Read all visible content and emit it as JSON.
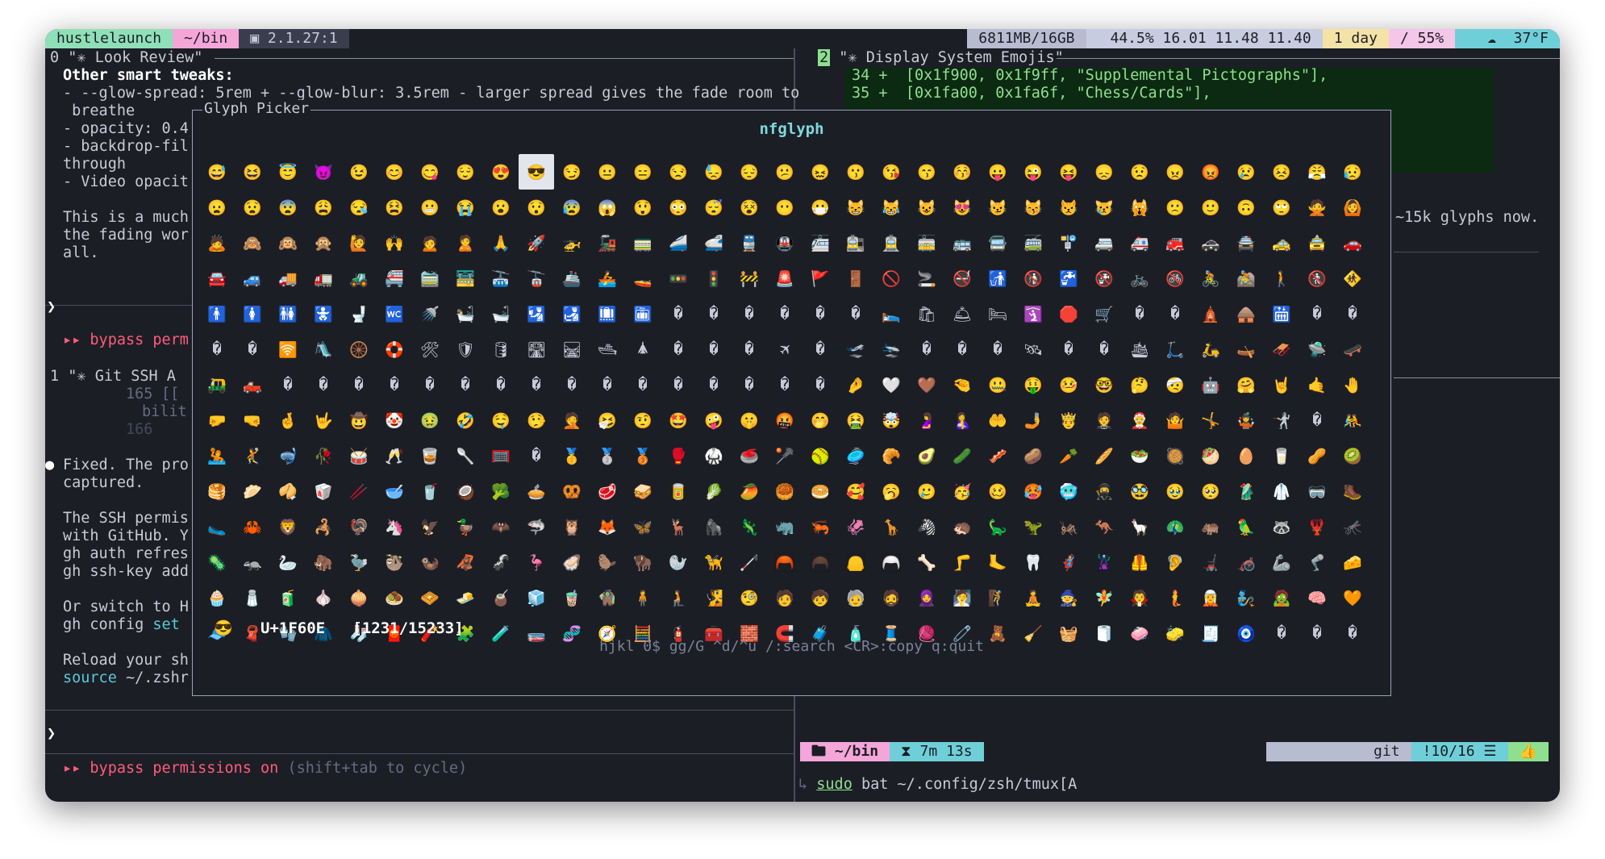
{
  "statusbar": {
    "session": "hustlelaunch",
    "dir": "~/bin",
    "pane_index": "2.1.27:1",
    "memory": "6811MB/16GB",
    "cpu": "44.5% 16.01 11.48 11.40",
    "uptime": "1 day",
    "disk": "/ 55%",
    "weather": "37°F"
  },
  "left_pane": {
    "window0_title": "0 \"✳ Look Review\"",
    "heading": "Other smart tweaks:",
    "line1": "- --glow-spread: 5rem + --glow-blur: 3.5rem - larger spread gives the fade room to",
    "line2": " breathe",
    "line3": "- opacity: 0.4",
    "line4": "- backdrop-fil",
    "line5": "through",
    "line6": "- Video opacit",
    "line7": "This is a much",
    "line8": "the fading wor",
    "line9": "all.",
    "prompt1": "❯",
    "bypass1": "▸▸ bypass perm",
    "window1_title": "1 \"✳ Git SSH A",
    "ln165": "165",
    "ln166": "166",
    "code165": "[[",
    "code_bilit": "bilit",
    "fixed1": "Fixed. The pro",
    "fixed2": "captured.",
    "ssh1": "The SSH permis",
    "ssh2": "with GitHub. Y",
    "ssh3": "gh auth refres",
    "ssh4": "gh ssh-key add",
    "or1": "Or switch to H",
    "or2": "gh config",
    "or2b": "set",
    "reload1": "Reload your sh",
    "reload2": "source",
    "reload2b": "~/.zshr",
    "prompt2": "❯",
    "bypass2a": "▸▸ bypass permissions on",
    "bypass2b": "(shift+tab to cycle)"
  },
  "right_pane": {
    "window_num": "2",
    "title": "\"✳ Display System Emojis\"",
    "line34": "34 +  [0x1f900, 0x1f9ff, \"Supplemental Pictographs\"],",
    "line35": "35 +  [0x1fa00, 0x1fa6f, \"Chess/Cards\"],",
    "glyphs_note": "~15k glyphs now.",
    "prompt_dir": "~/bin",
    "prompt_time": "7m 13s",
    "git_status": "!10/16",
    "command_sudo": "sudo",
    "command_rest": "bat ~/.config/zsh/tmux[A"
  },
  "picker": {
    "title": "Glyph Picker",
    "name": "nfglyph",
    "selected_glyph": "😎",
    "codepoint": "U+1F60E",
    "position": "[1231/15233]",
    "hints": "hjkl 0$ gg/G ^d/^u /:search <CR>:copy q:quit",
    "selected_index": 9,
    "glyphs": [
      "😅",
      "😆",
      "😇",
      "😈",
      "😉",
      "😊",
      "😋",
      "😌",
      "😍",
      "😎",
      "😏",
      "😐",
      "😑",
      "😒",
      "😓",
      "😔",
      "😕",
      "😖",
      "😗",
      "😘",
      "😙",
      "😚",
      "😛",
      "😜",
      "😝",
      "😞",
      "😟",
      "😠",
      "😡",
      "😢",
      "😣",
      "😤",
      "😥",
      "😦",
      "😧",
      "😨",
      "😩",
      "😪",
      "😫",
      "😬",
      "😭",
      "😮",
      "😯",
      "😰",
      "😱",
      "😲",
      "😳",
      "😴",
      "😵",
      "😶",
      "😷",
      "😸",
      "😹",
      "😺",
      "😻",
      "😼",
      "😽",
      "😾",
      "😿",
      "🙀",
      "🙁",
      "🙂",
      "🙃",
      "🙄",
      "🙅",
      "🙆",
      "🙇",
      "🙈",
      "🙉",
      "🙊",
      "🙋",
      "🙌",
      "🙍",
      "🙎",
      "🙏",
      "🚀",
      "🚁",
      "🚂",
      "🚃",
      "🚄",
      "🚅",
      "🚆",
      "🚇",
      "🚈",
      "🚉",
      "🚊",
      "🚋",
      "🚌",
      "🚍",
      "🚎",
      "🚏",
      "🚐",
      "🚑",
      "🚒",
      "🚓",
      "🚔",
      "🚕",
      "🚖",
      "🚗",
      "🚘",
      "🚙",
      "🚚",
      "🚛",
      "🚜",
      "🚝",
      "🚞",
      "🚟",
      "🚠",
      "🚡",
      "🚢",
      "🚣",
      "🚤",
      "🚥",
      "🚦",
      "🚧",
      "🚨",
      "🚩",
      "🚪",
      "🚫",
      "🚬",
      "🚭",
      "🚮",
      "🚯",
      "🚰",
      "🚱",
      "🚲",
      "🚳",
      "🚴",
      "🚵",
      "🚶",
      "🚷",
      "🚸",
      "🚹",
      "🚺",
      "🚻",
      "🚼",
      "🚽",
      "🚾",
      "🚿",
      "🛀",
      "🛁",
      "🛂",
      "🛃",
      "🛄",
      "🛅",
      "�",
      "�",
      "�",
      "�",
      "�",
      "�",
      "🛌",
      "🛍",
      "🛎",
      "🛏",
      "🛐",
      "🛑",
      "🛒",
      "�",
      "�",
      "🛕",
      "🛖",
      "🛗",
      "�",
      "�",
      "�",
      "�",
      "🛜",
      "🛝",
      "🛞",
      "🛟",
      "🛠",
      "🛡",
      "🛢",
      "🛣",
      "🛤",
      "🛥",
      "🛦",
      "�",
      "�",
      "�",
      "🛪",
      "�",
      "🛫",
      "🛬",
      "�",
      "�",
      "�",
      "🛰",
      "�",
      "�",
      "🛳",
      "🛴",
      "🛵",
      "🛶",
      "🛷",
      "🛸",
      "🛹",
      "🛺",
      "🛻",
      "�",
      "�",
      "�",
      "�",
      "�",
      "�",
      "�",
      "�",
      "�",
      "�",
      "�",
      "�",
      "�",
      "�",
      "�",
      "�",
      "🤌",
      "🤍",
      "🤎",
      "🤏",
      "🤐",
      "🤑",
      "🤒",
      "🤓",
      "🤔",
      "🤕",
      "🤖",
      "🤗",
      "🤘",
      "🤙",
      "🤚",
      "🤛",
      "🤜",
      "🤞",
      "🤟",
      "🤠",
      "🤡",
      "🤢",
      "🤣",
      "🤤",
      "🤥",
      "🤦",
      "🤧",
      "🤨",
      "🤩",
      "🤪",
      "🤫",
      "🤬",
      "🤭",
      "🤮",
      "🤯",
      "🤰",
      "🤱",
      "🤲",
      "🤳",
      "🤴",
      "🤵",
      "🤶",
      "🤷",
      "🤸",
      "🤹",
      "🤺",
      "�",
      "🤼",
      "🤽",
      "🤾",
      "🤿",
      "🥀",
      "🥁",
      "🥂",
      "🥃",
      "🥄",
      "🥅",
      "�",
      "🥇",
      "🥈",
      "🥉",
      "🥊",
      "🥋",
      "🥌",
      "🥍",
      "🥎",
      "🥏",
      "🥐",
      "🥑",
      "🥒",
      "🥓",
      "🥔",
      "🥕",
      "🥖",
      "🥗",
      "🥘",
      "🥙",
      "🥚",
      "🥛",
      "🥜",
      "🥝",
      "🥞",
      "🥟",
      "🥠",
      "🥡",
      "🥢",
      "🥣",
      "🥤",
      "🥥",
      "🥦",
      "🥧",
      "🥨",
      "🥩",
      "🥪",
      "🥫",
      "🥬",
      "🥭",
      "🥮",
      "🥯",
      "🥰",
      "🥱",
      "🥲",
      "🥳",
      "🥴",
      "🥵",
      "🥶",
      "🥷",
      "🥸",
      "🥹",
      "🥺",
      "🥻",
      "🥼",
      "🥽",
      "🥾",
      "🥿",
      "🦀",
      "🦁",
      "🦂",
      "🦃",
      "🦄",
      "🦅",
      "🦆",
      "🦇",
      "🦈",
      "🦉",
      "🦊",
      "🦋",
      "🦌",
      "🦍",
      "🦎",
      "🦏",
      "🦐",
      "🦑",
      "🦒",
      "🦓",
      "🦔",
      "🦕",
      "🦖",
      "🦗",
      "🦘",
      "🦙",
      "🦚",
      "🦛",
      "🦜",
      "🦝",
      "🦞",
      "🦟",
      "🦠",
      "🦡",
      "🦢",
      "🦣",
      "🦤",
      "🦥",
      "🦦",
      "🦧",
      "🦨",
      "🦩",
      "🦪",
      "🦫",
      "🦬",
      "🦭",
      "🦮",
      "🦯",
      "🦰",
      "🦱",
      "🦲",
      "🦳",
      "🦴",
      "🦵",
      "🦶",
      "🦷",
      "🦸",
      "🦹",
      "🦺",
      "🦻",
      "🦼",
      "🦽",
      "🦾",
      "🦿",
      "🧀",
      "🧁",
      "🧂",
      "🧃",
      "🧄",
      "🧅",
      "🧆",
      "🧇",
      "🧈",
      "🧉",
      "🧊",
      "🧋",
      "🧌",
      "🧍",
      "🧎",
      "🧏",
      "🧐",
      "🧑",
      "🧒",
      "🧓",
      "🧔",
      "🧕",
      "🧖",
      "🧗",
      "🧘",
      "🧙",
      "🧚",
      "🧛",
      "🧜",
      "🧝",
      "🧞",
      "🧟",
      "🧠",
      "🧡",
      "🧢",
      "🧣",
      "🧤",
      "🧥",
      "🧦",
      "🧧",
      "🧨",
      "🧩",
      "🧪",
      "🧫",
      "🧬",
      "🧭",
      "🧮",
      "🧯",
      "🧰",
      "🧱",
      "🧲",
      "🧳",
      "🧴",
      "🧵",
      "🧶",
      "🧷",
      "🧸",
      "🧹",
      "🧺",
      "🧻",
      "🧼",
      "🧽",
      "🧾",
      "🧿",
      "�",
      "�",
      "�"
    ]
  },
  "colors": {
    "session_bg": "#8fe0b8",
    "dir_bg": "#f4a6d8",
    "mem_bg": "#b8bcd0",
    "cpu_bg": "#c8cce0",
    "uptime_bg": "#f4e2a6",
    "disk_bg": "#f4c6e8",
    "weather_bg": "#6fcfd8",
    "accent_green": "#8ee08e",
    "accent_red": "#ff5c7a"
  }
}
